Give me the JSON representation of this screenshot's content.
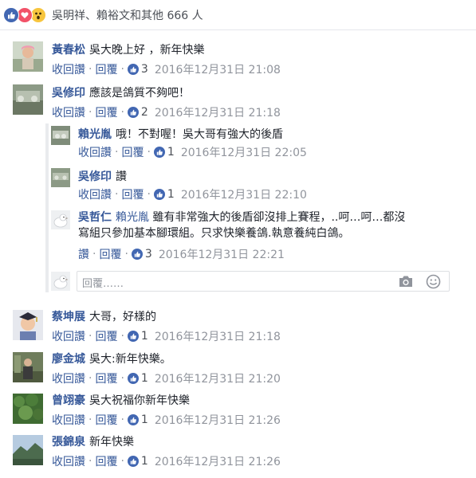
{
  "reactions": {
    "icons": [
      "like-icon",
      "love-icon",
      "wow-icon"
    ],
    "colors": {
      "like": "#4267b2",
      "love": "#f25268",
      "wow": "#f7c53e"
    },
    "summary": "吳明祥、賴裕文和其他 666 人"
  },
  "action_labels": {
    "unlike": "收回讚",
    "like": "讚",
    "reply": "回覆",
    "separator": "·"
  },
  "comments": [
    {
      "author": "黃春松",
      "text": "吳大晚上好 ，新年快樂",
      "likes": "3",
      "time": "2016年12月31日 21:08"
    },
    {
      "author": "吳修印",
      "text": "應該是鴿質不夠吧！",
      "likes": "2",
      "time": "2016年12月31日 21:18"
    },
    {
      "author": "蔡坤展",
      "text": "大哥，好樣的",
      "likes": "1",
      "time": "2016年12月31日 21:18"
    },
    {
      "author": "廖金城",
      "text": "吳大:新年快樂。",
      "likes": "1",
      "time": "2016年12月31日 21:20"
    },
    {
      "author": "曾翊豪",
      "text": "吳大祝福你新年快樂",
      "likes": "1",
      "time": "2016年12月31日 21:26"
    },
    {
      "author": "張錦泉",
      "text": "新年快樂",
      "likes": "1",
      "time": "2016年12月31日 21:26"
    }
  ],
  "replies": [
    {
      "author": "賴光胤",
      "text": "哦！不對喔！吳大哥有強大的後盾",
      "likes": "1",
      "time": "2016年12月31日 22:05"
    },
    {
      "author": "吳修印",
      "text": "讚",
      "likes": "1",
      "time": "2016年12月31日 22:10"
    },
    {
      "author": "吳哲仁",
      "mention": "賴光胤",
      "text_line1": "雖有非常強大的後盾卻沒排上賽程，..呵…呵…都沒",
      "text_line2": "寫組只參加基本腳環組。只求快樂養鴿.執意養純白鴿。",
      "likes": "3",
      "time": "2016年12月31日 22:21"
    }
  ],
  "reply_box": {
    "placeholder": "回覆……",
    "icons": [
      "camera-icon",
      "smile-icon"
    ]
  }
}
